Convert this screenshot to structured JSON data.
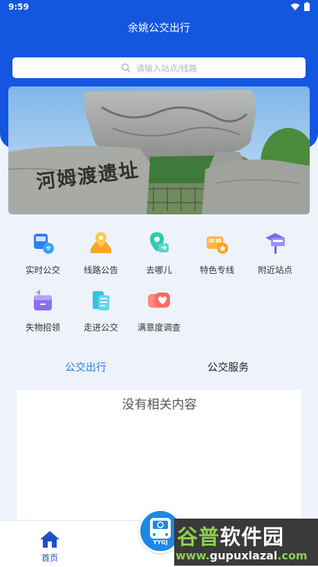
{
  "status_bar": {
    "time": "9:59"
  },
  "header": {
    "title": "余姚公交出行"
  },
  "search": {
    "placeholder": "请输入站点/线路"
  },
  "banner": {
    "carved_text": "河姆渡遗址"
  },
  "services": [
    {
      "label": "实时公交",
      "icon": "bus-realtime-icon"
    },
    {
      "label": "线路公告",
      "icon": "route-notice-icon"
    },
    {
      "label": "去哪儿",
      "icon": "destination-icon"
    },
    {
      "label": "特色专线",
      "icon": "special-line-icon"
    },
    {
      "label": "附近站点",
      "icon": "nearby-stop-icon"
    },
    {
      "label": "失物招领",
      "icon": "lost-found-icon"
    },
    {
      "label": "走进公交",
      "icon": "about-bus-icon"
    },
    {
      "label": "满意度调查",
      "icon": "survey-icon"
    }
  ],
  "tabs": {
    "active": "公交出行",
    "inactive": "公交服务"
  },
  "content": {
    "empty": "没有相关内容"
  },
  "bottom_nav": {
    "home_label": "首页",
    "fab_text": "YYGJ"
  },
  "watermark": {
    "brand_a": "谷普",
    "brand_b": "软件园",
    "url_a": "www.",
    "url_b": "gupuxlazal",
    "url_c": ".com"
  },
  "colors": {
    "primary": "#1456e0",
    "active_tab": "#2b7de0"
  }
}
